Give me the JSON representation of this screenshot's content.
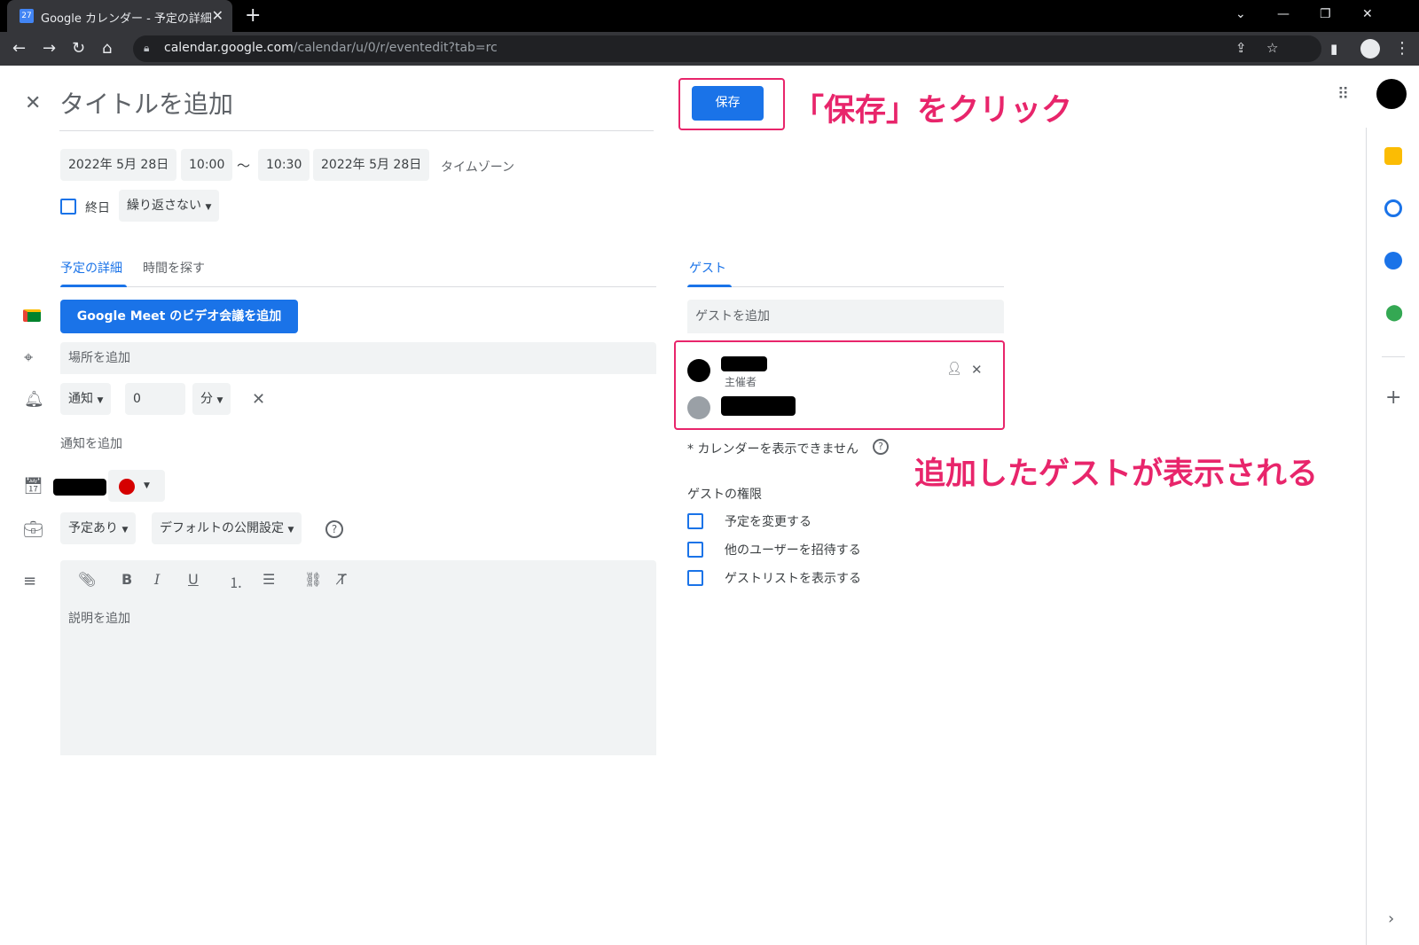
{
  "browser": {
    "tab_title": "Google カレンダー - 予定の詳細",
    "tab_favicon": "27",
    "url_host": "calendar.google.com",
    "url_path": "/calendar/u/0/r/eventedit?tab=rc"
  },
  "event": {
    "title_placeholder": "タイトルを追加",
    "start_date": "2022年 5月 28日",
    "start_time": "10:00",
    "separator": "〜",
    "end_time": "10:30",
    "end_date": "2022年 5月 28日",
    "timezone_label": "タイムゾーン",
    "allday_label": "終日",
    "repeat_label": "繰り返さない",
    "save_label": "保存"
  },
  "tabs": {
    "details": "予定の詳細",
    "find_time": "時間を探す",
    "guests": "ゲスト"
  },
  "details": {
    "meet_button": "Google Meet のビデオ会議を追加",
    "location_placeholder": "場所を追加",
    "notification_type": "通知",
    "notification_value": "0",
    "notification_unit": "分",
    "add_notification": "通知を追加",
    "busy_status": "予定あり",
    "visibility": "デフォルトの公開設定",
    "description_placeholder": "説明を追加",
    "calendar_color": "#d50000"
  },
  "guests": {
    "add_placeholder": "ゲストを追加",
    "organizer_label": "主催者",
    "calendar_note": "* カレンダーを表示できません",
    "permissions_title": "ゲストの権限",
    "permissions": [
      "予定を変更する",
      "他のユーザーを招待する",
      "ゲストリストを表示する"
    ]
  },
  "annotations": {
    "save_hint": "「保存」をクリック",
    "guest_hint": "追加したゲストが表示される"
  },
  "colors": {
    "accent": "#1a73e8",
    "annotation": "#e8256b"
  }
}
